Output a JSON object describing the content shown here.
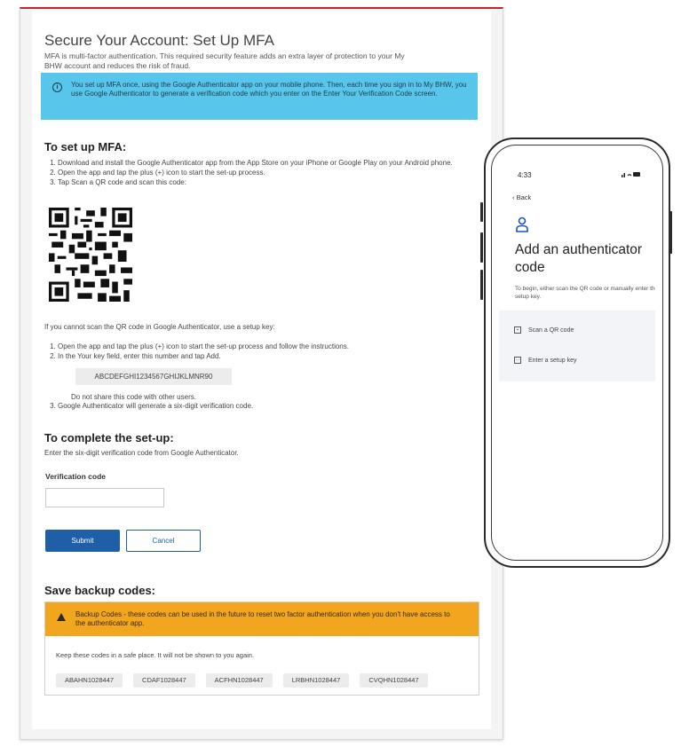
{
  "mfa_page": {
    "title": "Secure Your Account: Set Up MFA",
    "description": "MFA is multi-factor authentication. This required security feature adds an extra layer of protection to your My BHW account and reduces the risk of fraud.",
    "info_text": "You set up MFA once, using the Google Authenticator app on your mobile phone. Then, each time you sign in to My BHW, you use Google Authenticator to generate a verification code which you enter on the Enter Your Verification Code screen.",
    "setup_heading": "To set up MFA:",
    "setup_steps": [
      "Download and install the Google Authenticator app from the App Store on your iPhone or Google Play on your Android phone.",
      "Open the app and tap the plus (+) icon to start the set-up process.",
      "Tap Scan a QR code and scan this code:"
    ],
    "cannot_scan_text": "If you cannot scan the QR code in Google Authenticator, use a setup key:",
    "key_steps": [
      "Open the app and tap the plus (+) icon to start the set-up process and follow the instructions.",
      "In the Your key field, enter this number and tap Add."
    ],
    "setup_key": "ABCDEFGHI1234567GHIJKLMNR90",
    "no_share_text": "Do not share this code with other users.",
    "key_step_3": "Google Authenticator will generate a six-digit verification code.",
    "complete_heading": "To complete the set-up:",
    "complete_text": "Enter the six-digit verification code from Google Authenticator.",
    "verification_label": "Verification code",
    "verification_value": "",
    "submit_label": "Submit",
    "cancel_label": "Cancel",
    "backup_heading": "Save backup codes:",
    "backup_warning": "Backup Codes - these codes can be used in the future to reset two factor authentication when you don't have access to the authenticator app.",
    "backup_note": "Keep these codes in a safe place. It will not be shown to you again.",
    "backup_codes": [
      "ABAHN1028447",
      "CDAF1028447",
      "ACFHN1028447",
      "LRBHN1028447",
      "CVQHN1028447"
    ],
    "colors": {
      "accent_red": "#c0262d",
      "info_blue": "#58c5ea",
      "button_blue": "#1e5fa8",
      "warning_orange": "#f2a51f"
    }
  },
  "phone": {
    "time": "4:33",
    "status_icons": "signal-wifi-battery",
    "back_label": "Back",
    "heading": "Add an authenticator code",
    "description": "To begin, either scan the QR code or manually enter the setup key.",
    "options": [
      {
        "label": "Scan a QR code",
        "icon": "qr-scan-icon"
      },
      {
        "label": "Enter a setup key",
        "icon": "keyboard-icon"
      }
    ]
  }
}
